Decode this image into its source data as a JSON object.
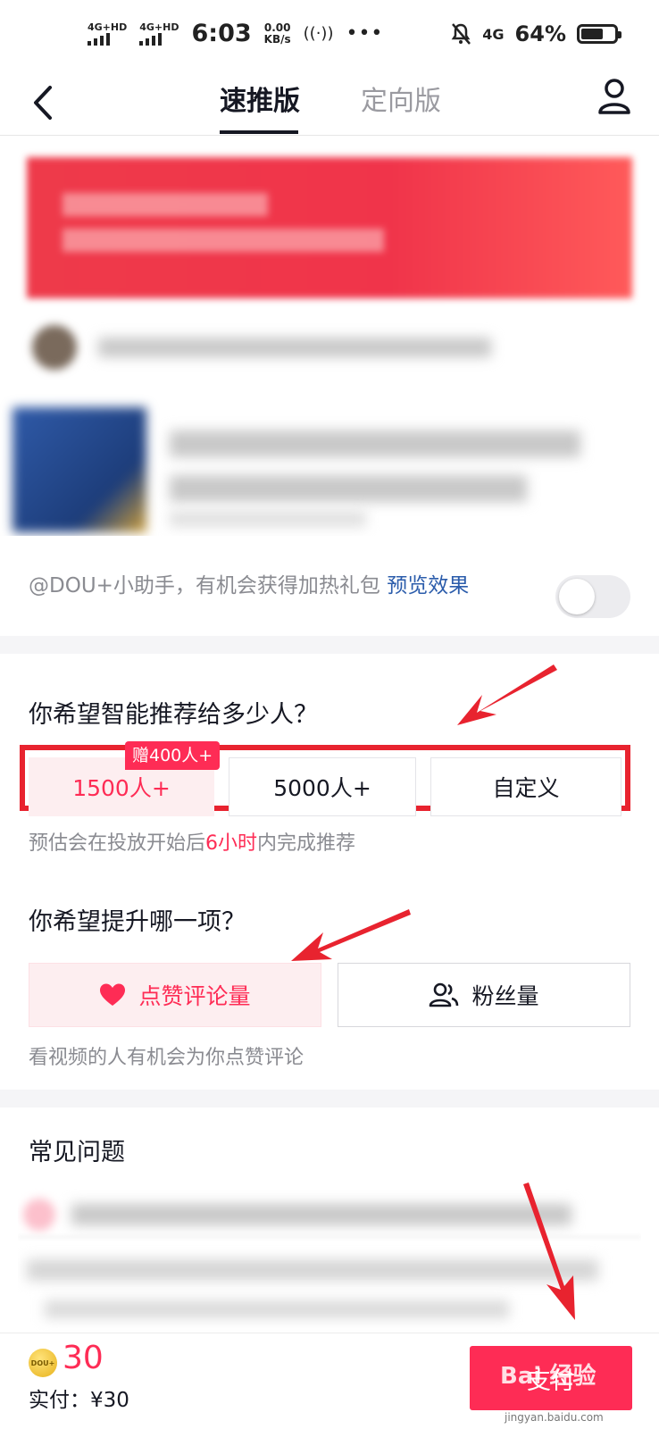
{
  "status_bar": {
    "signal1": "4G+HD",
    "signal2": "4G+HD",
    "time": "6:03",
    "speed_value": "0.00",
    "speed_unit": "KB/s",
    "network": "4G",
    "battery": "64%"
  },
  "nav": {
    "tabs": [
      {
        "label": "速推版",
        "active": true
      },
      {
        "label": "定向版",
        "active": false
      }
    ]
  },
  "helper": {
    "text": "@DOU+小助手，有机会获得加热礼包",
    "link": "预览效果",
    "toggle_on": false
  },
  "recommend": {
    "question": "你希望智能推荐给多少人？",
    "options": [
      {
        "label": "1500人+",
        "selected": true
      },
      {
        "label": "5000人+",
        "selected": false
      },
      {
        "label": "自定义",
        "selected": false
      }
    ],
    "gift_badge": "赠400人+",
    "estimate_prefix": "预估会在投放开始后",
    "estimate_highlight": "6小时",
    "estimate_suffix": "内完成推荐"
  },
  "goal": {
    "question": "你希望提升哪一项？",
    "options": [
      {
        "label": "点赞评论量",
        "icon": "heart-icon",
        "selected": true
      },
      {
        "label": "粉丝量",
        "icon": "users-icon",
        "selected": false
      }
    ],
    "description": "看视频的人有机会为你点赞评论"
  },
  "faq": {
    "title": "常见问题"
  },
  "footer": {
    "coin_label": "DOU+",
    "amount": "30",
    "paid_label": "实付：¥30",
    "pay_button": "支付"
  },
  "watermark": {
    "main": "Bai 经验",
    "url": "jingyan.baidu.com"
  },
  "colors": {
    "accent": "#fe2c55",
    "annotation_red": "#e8232f",
    "link": "#2b5cab"
  }
}
